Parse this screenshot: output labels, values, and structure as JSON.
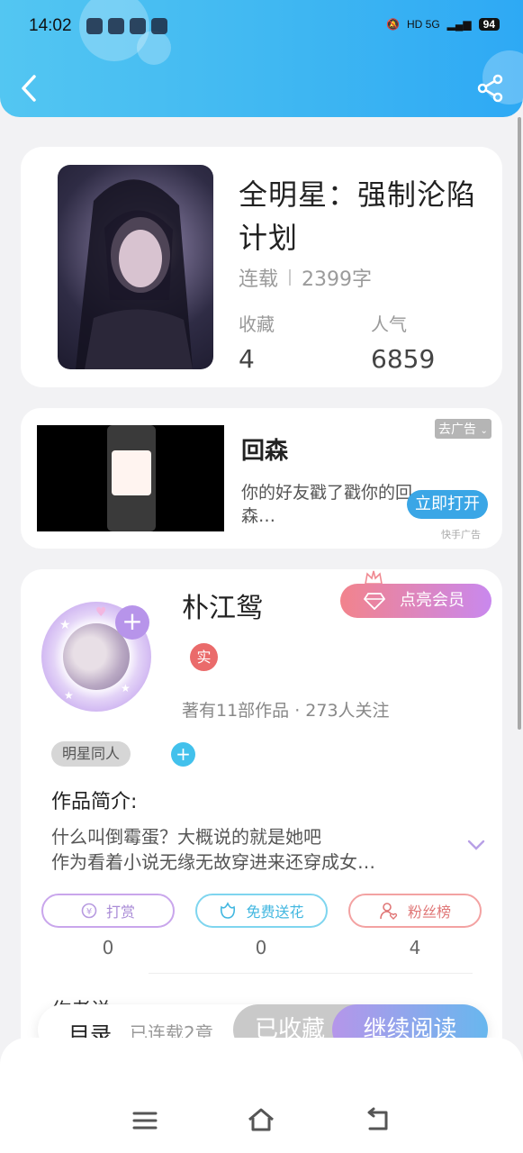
{
  "status_bar": {
    "time": "14:02",
    "network": "HD 5G",
    "battery": "94"
  },
  "book": {
    "title": "全明星：强制沦陷计划",
    "status": "连载",
    "word_count": "2399字",
    "favorites_label": "收藏",
    "favorites_value": "4",
    "popularity_label": "人气",
    "popularity_value": "6859"
  },
  "ad": {
    "title": "回森",
    "description": "你的好友戳了戳你的回森…",
    "remove_label": "去广告",
    "open_label": "立即打开",
    "source": "快手广告"
  },
  "author": {
    "name": "朴江鸳",
    "vip_label": "点亮会员",
    "real_tag": "实",
    "meta": "著有11部作品 · 273人关注",
    "tag": "明星同人",
    "intro_label": "作品简介:",
    "intro_line1": "什么叫倒霉蛋？大概说的就是她吧",
    "intro_line2": "作为看着小说无缘无故穿进来还穿成女…",
    "reward_label": "打赏",
    "reward_count": "0",
    "flower_label": "免费送花",
    "flower_count": "0",
    "fans_label": "粉丝榜",
    "fans_count": "4",
    "author_says_label": "作者说"
  },
  "bottom_bar": {
    "toc_label": "目录",
    "toc_sub": "已连载2章",
    "collected_label": "已收藏",
    "continue_label": "继续阅读"
  },
  "colors": {
    "header_blue": "#3fb7f2",
    "vip_gradient_start": "#f2838c",
    "vip_gradient_end": "#c988ee",
    "read_gradient_start": "#b596ea",
    "read_gradient_end": "#68b7ee"
  },
  "icons": {
    "back": "chevron-left-icon",
    "share": "share-icon",
    "nav_menu": "menu-icon",
    "nav_home": "home-icon",
    "nav_back": "return-icon"
  }
}
